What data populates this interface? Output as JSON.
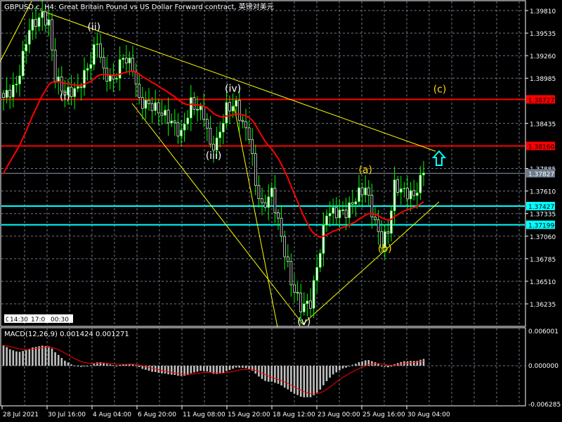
{
  "window": {
    "title": "GBPUSD.c, H4:  Great Britain Pound vs US Dollar Forward contract, 英镑对美元"
  },
  "colors": {
    "background": "#000000",
    "grid": "#6c7a8c",
    "bull": "#ffffff",
    "wick": "#00ff00",
    "ma": "#ff0000",
    "trendline": "#ffff00",
    "resistance": "#ff0000",
    "support": "#00ffff",
    "wave_label_primary": "#ffffff",
    "wave_label_secondary": "#ffd700",
    "arrow": "#00ffff"
  },
  "chart_data": {
    "type": "candlestick",
    "symbol": "GBPUSD.c",
    "timeframe": "H4",
    "title": "GBPUSD.c, H4:  Great Britain Pound vs US Dollar Forward contract, 英镑对美元",
    "ylim": [
      1.3595,
      1.3995
    ],
    "price_ticks": [
      "1.39810",
      "1.39535",
      "1.39260",
      "1.38985",
      "1.38435",
      "1.37885",
      "1.37610",
      "1.37335",
      "1.37060",
      "1.36785",
      "1.36510",
      "1.36235"
    ],
    "time_ticks": [
      "28 Jul 2021",
      "30 Jul 16:00",
      "4 Aug 04:00",
      "6 Aug 20:00",
      "11 Aug 08:00",
      "15 Aug 20:00",
      "18 Aug 12:00",
      "23 Aug 00:00",
      "25 Aug 16:00",
      "30 Aug 04:00"
    ],
    "close_waypoints": [
      [
        0,
        1.3875
      ],
      [
        4,
        1.389
      ],
      [
        8,
        1.396
      ],
      [
        12,
        1.3975
      ],
      [
        14,
        1.3965
      ],
      [
        16,
        1.39
      ],
      [
        19,
        1.388
      ],
      [
        23,
        1.3885
      ],
      [
        27,
        1.392
      ],
      [
        29,
        1.3945
      ],
      [
        31,
        1.3905
      ],
      [
        34,
        1.3895
      ],
      [
        37,
        1.3925
      ],
      [
        40,
        1.3912
      ],
      [
        42,
        1.387
      ],
      [
        46,
        1.3865
      ],
      [
        51,
        1.385
      ],
      [
        55,
        1.383
      ],
      [
        58,
        1.3868
      ],
      [
        62,
        1.3855
      ],
      [
        64,
        1.3815
      ],
      [
        66,
        1.382
      ],
      [
        69,
        1.3862
      ],
      [
        72,
        1.3866
      ],
      [
        74,
        1.3842
      ],
      [
        76,
        1.383
      ],
      [
        78,
        1.377
      ],
      [
        80,
        1.374
      ],
      [
        83,
        1.376
      ],
      [
        86,
        1.3705
      ],
      [
        89,
        1.365
      ],
      [
        92,
        1.362
      ],
      [
        95,
        1.3625
      ],
      [
        98,
        1.369
      ],
      [
        100,
        1.3735
      ],
      [
        106,
        1.3735
      ],
      [
        110,
        1.3758
      ],
      [
        112,
        1.3765
      ],
      [
        115,
        1.3722
      ],
      [
        117,
        1.3698
      ],
      [
        119,
        1.3712
      ],
      [
        121,
        1.3768
      ],
      [
        124,
        1.376
      ],
      [
        127,
        1.3755
      ],
      [
        130,
        1.3783
      ]
    ],
    "price_levels": [
      {
        "label": "1.38727",
        "value": 1.38727,
        "kind": "resistance"
      },
      {
        "label": "1.38160",
        "value": 1.3816,
        "kind": "resistance"
      },
      {
        "label": "1.37827",
        "value": 1.37827,
        "kind": "current"
      },
      {
        "label": "1.37427",
        "value": 1.37427,
        "kind": "support"
      },
      {
        "label": "1.37199",
        "value": 1.37199,
        "kind": "support"
      }
    ],
    "wave_labels": [
      {
        "text": "(i)",
        "bar": 19,
        "price": 1.3872,
        "tier": "primary"
      },
      {
        "text": "(ii)",
        "bar": 28,
        "price": 1.3957,
        "tier": "primary"
      },
      {
        "text": "(iii)",
        "bar": 65,
        "price": 1.38,
        "tier": "primary"
      },
      {
        "text": "(iv)",
        "bar": 71,
        "price": 1.3882,
        "tier": "primary"
      },
      {
        "text": "(v)",
        "bar": 93,
        "price": 1.3598,
        "tier": "primary"
      },
      {
        "text": "(a)",
        "bar": 112,
        "price": 1.3783,
        "tier": "secondary"
      },
      {
        "text": "(b)",
        "bar": 118,
        "price": 1.3687,
        "tier": "secondary"
      },
      {
        "text": "(c)",
        "bar": 135,
        "price": 1.3881,
        "tier": "secondary"
      }
    ],
    "macd": {
      "label": "MACD(12,26,9) 0.001424 0.001271",
      "ticks": [
        "0.006001",
        "0.000000",
        "-0.006285"
      ],
      "ylim": [
        -0.006285,
        0.006001
      ]
    },
    "period_separators": [
      "0",
      "14:30",
      "17:0",
      "00:30"
    ]
  }
}
